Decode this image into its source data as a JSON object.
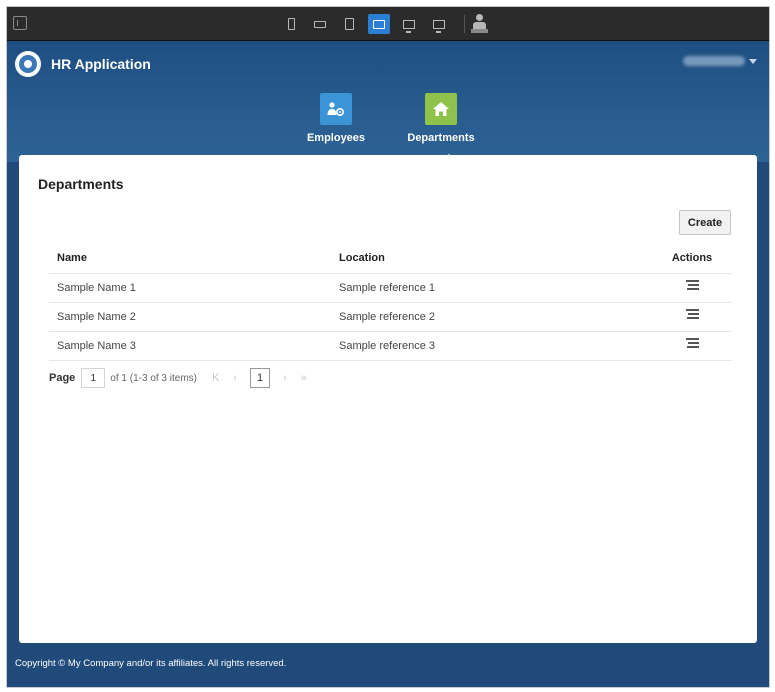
{
  "app": {
    "title": "HR Application"
  },
  "device_toolbar": {
    "devices": [
      "phone-portrait",
      "phone-landscape",
      "tablet-portrait",
      "tablet-landscape",
      "desktop",
      "large-desktop"
    ],
    "active_device": "tablet-landscape"
  },
  "nav": {
    "items": [
      {
        "label": "Employees",
        "icon": "employees-icon",
        "color": "#3a94d6"
      },
      {
        "label": "Departments",
        "icon": "home-icon",
        "color": "#8fc24a"
      }
    ],
    "active": "Departments"
  },
  "page": {
    "title": "Departments",
    "create_label": "Create"
  },
  "table": {
    "columns": [
      "Name",
      "Location",
      "Actions"
    ],
    "rows": [
      {
        "name": "Sample Name 1",
        "location": "Sample reference 1"
      },
      {
        "name": "Sample Name 2",
        "location": "Sample reference 2"
      },
      {
        "name": "Sample Name 3",
        "location": "Sample reference 3"
      }
    ]
  },
  "pager": {
    "label": "Page",
    "current": "1",
    "info": "of 1 (1-3 of 3 items)",
    "first": "K",
    "prev": "‹",
    "next": "›",
    "last": "»"
  },
  "footer": {
    "text": "Copyright © My Company and/or its affiliates. All rights reserved."
  },
  "colors": {
    "header_bg": "#1f4a7a",
    "employees_tile": "#3a94d6",
    "departments_tile": "#8fc24a",
    "active_device": "#2a7fd4"
  }
}
